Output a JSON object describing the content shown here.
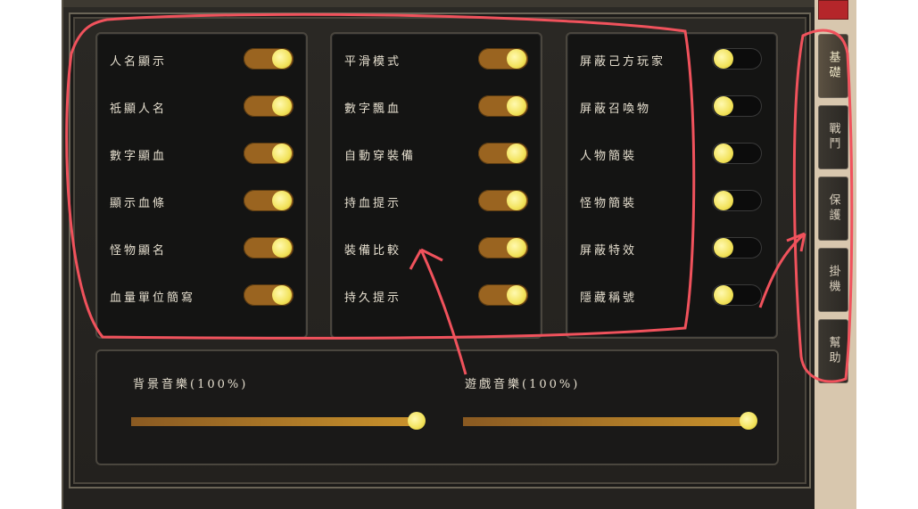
{
  "panels": [
    {
      "items": [
        {
          "label": "人名顯示",
          "on": true
        },
        {
          "label": "祗顯人名",
          "on": true
        },
        {
          "label": "數字顯血",
          "on": true
        },
        {
          "label": "顯示血條",
          "on": true
        },
        {
          "label": "怪物顯名",
          "on": true
        },
        {
          "label": "血量單位簡寫",
          "on": true
        }
      ]
    },
    {
      "items": [
        {
          "label": "平滑模式",
          "on": true
        },
        {
          "label": "數字飄血",
          "on": true
        },
        {
          "label": "自動穿裝備",
          "on": true
        },
        {
          "label": "持血提示",
          "on": true
        },
        {
          "label": "裝備比較",
          "on": true
        },
        {
          "label": "持久提示",
          "on": true
        }
      ]
    },
    {
      "items": [
        {
          "label": "屏蔽己方玩家",
          "on": false
        },
        {
          "label": "屏蔽召喚物",
          "on": false
        },
        {
          "label": "人物簡裝",
          "on": false
        },
        {
          "label": "怪物簡裝",
          "on": false
        },
        {
          "label": "屏蔽特效",
          "on": false
        },
        {
          "label": "隱藏稱號",
          "on": false
        }
      ]
    }
  ],
  "audio": {
    "bgm_label": "背景音樂(100%)",
    "bgm_level": 1.0,
    "game_label": "遊戲音樂(100%)",
    "game_level": 1.0
  },
  "side_tabs": [
    {
      "label": "基礎",
      "active": true
    },
    {
      "label": "戰鬥",
      "active": false
    },
    {
      "label": "保護",
      "active": false
    },
    {
      "label": "掛機",
      "active": false
    },
    {
      "label": "幫助",
      "active": false
    }
  ],
  "colors": {
    "toggle_on": "#9a6420",
    "toggle_off": "#0c0c0c",
    "knob": "#f2e25a",
    "annotation": "#f0525c"
  }
}
